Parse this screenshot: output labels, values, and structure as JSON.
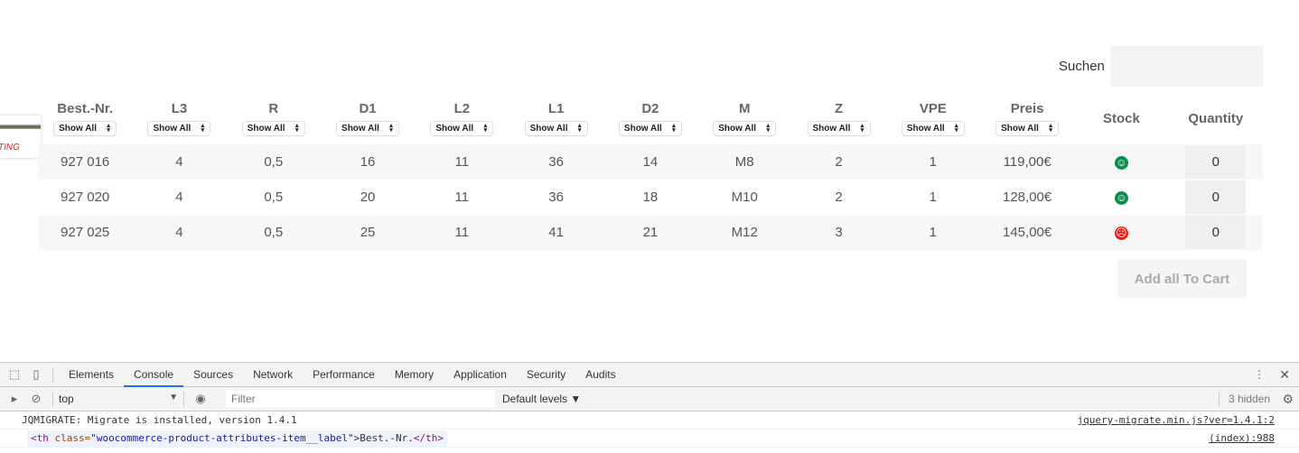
{
  "search": {
    "label": "Suchen",
    "value": ""
  },
  "card": {
    "text": "TING"
  },
  "table": {
    "columns": [
      "Best.-Nr.",
      "L3",
      "R",
      "D1",
      "L2",
      "L1",
      "D2",
      "M",
      "Z",
      "VPE",
      "Preis"
    ],
    "filter_label": "Show All",
    "stock_header": "Stock",
    "quantity_header": "Quantity",
    "rows": [
      {
        "cells": [
          "927 016",
          "4",
          "0,5",
          "16",
          "11",
          "36",
          "14",
          "M8",
          "2",
          "1",
          "119,00€"
        ],
        "stock": "in-stock",
        "qty": "0"
      },
      {
        "cells": [
          "927 020",
          "4",
          "0,5",
          "20",
          "11",
          "36",
          "18",
          "M10",
          "2",
          "1",
          "128,00€"
        ],
        "stock": "in-stock",
        "qty": "0"
      },
      {
        "cells": [
          "927 025",
          "4",
          "0,5",
          "25",
          "11",
          "41",
          "21",
          "M12",
          "3",
          "1",
          "145,00€"
        ],
        "stock": "out-of-stock",
        "qty": "0"
      }
    ]
  },
  "colors": {
    "in_stock": "#0a8f4f",
    "out_of_stock": "#f0180c"
  },
  "cart_button": "Add all To Cart",
  "devtools": {
    "tabs": [
      "Elements",
      "Console",
      "Sources",
      "Network",
      "Performance",
      "Memory",
      "Application",
      "Security",
      "Audits"
    ],
    "active_tab": "Console",
    "context": "top",
    "filter_placeholder": "Filter",
    "levels": "Default levels ▼",
    "hidden": "3 hidden",
    "messages": [
      {
        "text": "JQMIGRATE: Migrate is installed, version 1.4.1",
        "source": "jquery-migrate.min.js?ver=1.4.1:2"
      },
      {
        "tag_open": "<th",
        "attr": " class=",
        "val": "\"woocommerce-product-attributes-item__label\"",
        "content": ">Best.-Nr.",
        "tag_close": "</th>",
        "source": "(index):988"
      }
    ]
  }
}
